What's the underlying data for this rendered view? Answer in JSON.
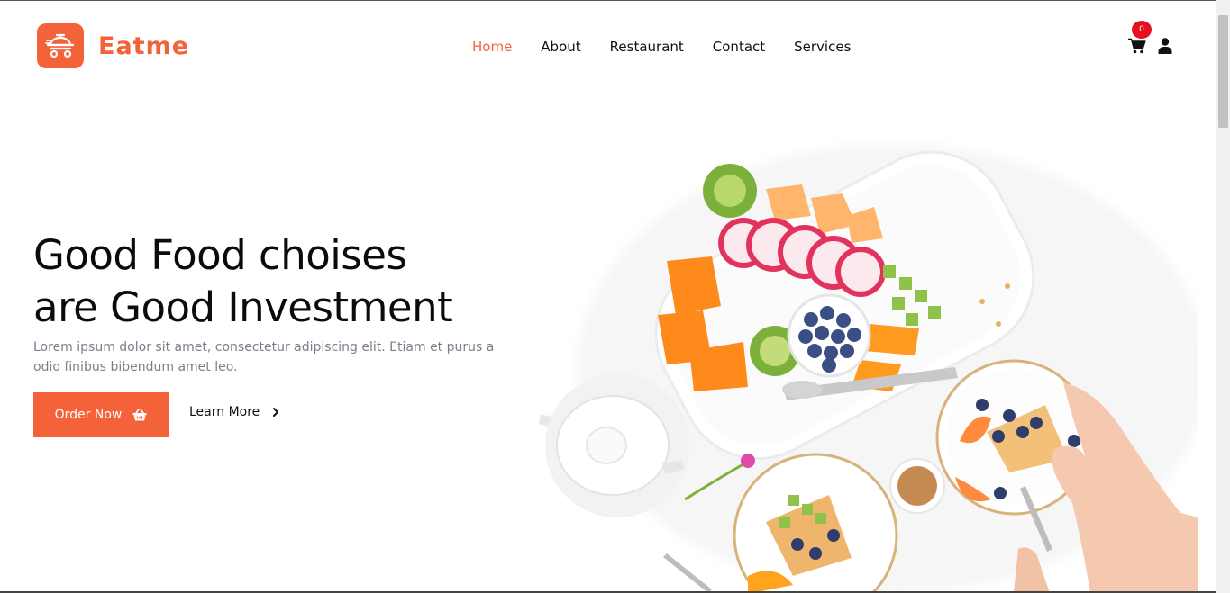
{
  "brand": {
    "name": "Eatme",
    "color": "#f4623a"
  },
  "nav": {
    "items": [
      {
        "label": "Home",
        "active": true
      },
      {
        "label": "About",
        "active": false
      },
      {
        "label": "Restaurant",
        "active": false
      },
      {
        "label": "Contact",
        "active": false
      },
      {
        "label": "Services",
        "active": false
      }
    ]
  },
  "header": {
    "cart_icon": "cart-icon",
    "cart_count": "0",
    "user_icon": "user-icon"
  },
  "hero": {
    "title_line1": "Good Food choises",
    "title_line2": "are Good Investment",
    "description": "Lorem ipsum dolor sit amet, consectetur adipiscing elit. Etiam et purus a odio finibus bibendum amet leo.",
    "order_button": "Order Now",
    "order_icon": "basket-icon",
    "learn_button": "Learn More",
    "learn_icon": "chevron-right-icon",
    "image": "food-platter-image"
  },
  "colors": {
    "accent": "#f4623a",
    "badge": "#e8101f",
    "text_muted": "#7a7f8c"
  }
}
